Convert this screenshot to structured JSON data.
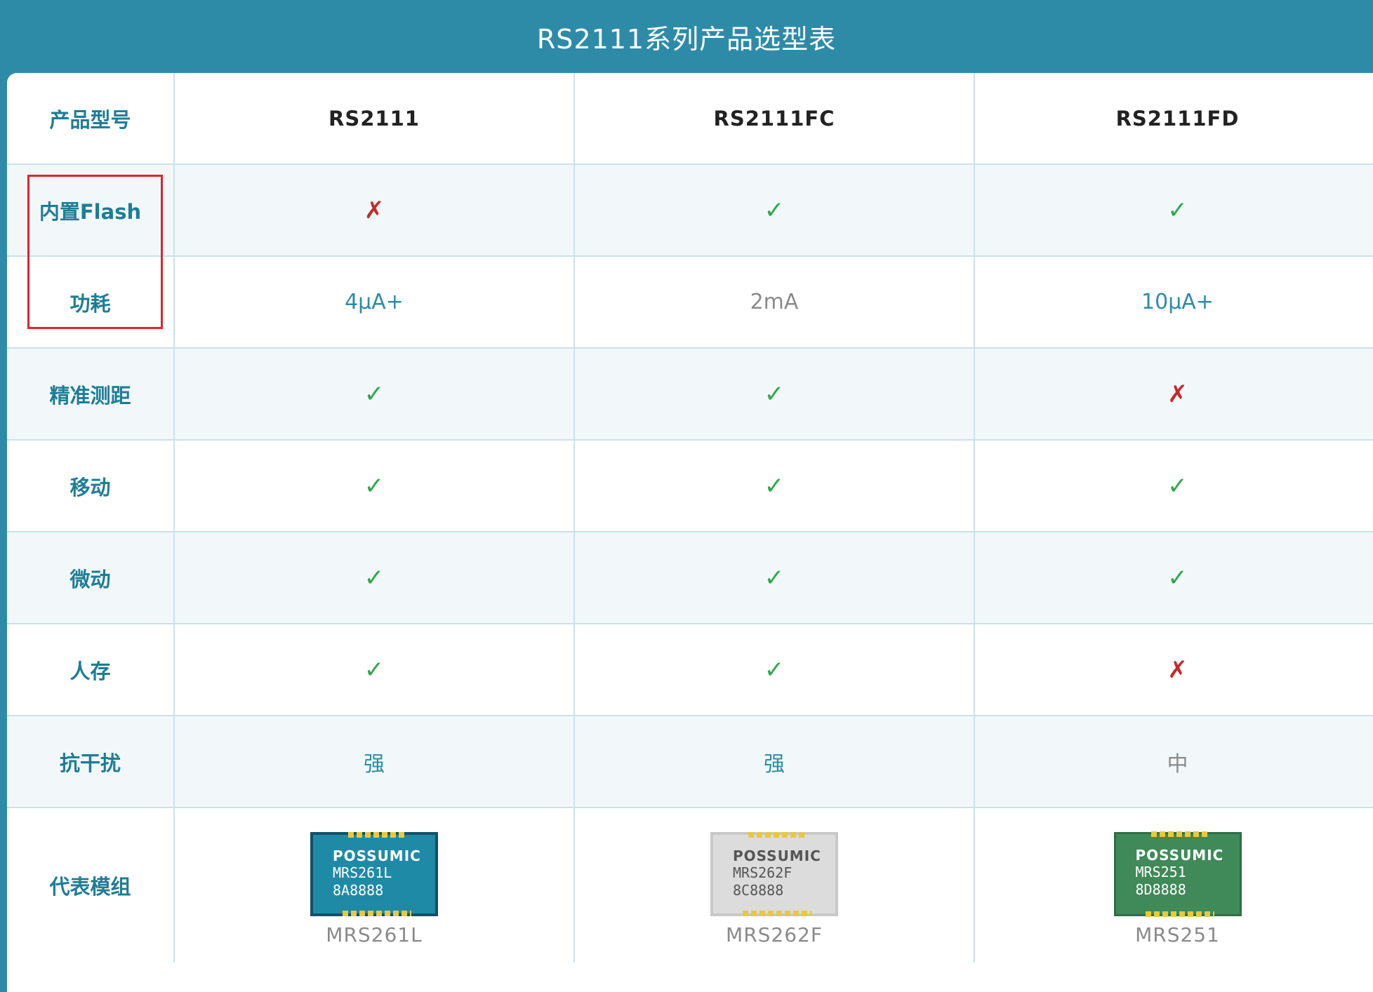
{
  "title": "RS2111系列产品选型表",
  "header": {
    "label": "产品型号",
    "models": [
      "RS2111",
      "RS2111FC",
      "RS2111FD"
    ]
  },
  "rows": [
    {
      "label": "内置Flash",
      "values": [
        "✗",
        "✓",
        "✓"
      ]
    },
    {
      "label": "功耗",
      "values": [
        "4μA+",
        "2mA",
        "10μA+"
      ]
    },
    {
      "label": "精准测距",
      "values": [
        "✓",
        "✓",
        "✗"
      ]
    },
    {
      "label": "移动",
      "values": [
        "✓",
        "✓",
        "✓"
      ]
    },
    {
      "label": "微动",
      "values": [
        "✓",
        "✓",
        "✓"
      ]
    },
    {
      "label": "人存",
      "values": [
        "✓",
        "✓",
        "✗"
      ]
    },
    {
      "label": "抗干扰",
      "values": [
        "强",
        "强",
        "中"
      ]
    }
  ],
  "modules": {
    "label": "代表模组",
    "items": [
      {
        "brand": "POSSUMIC",
        "line1": "MRS261L",
        "line2": "8A8888",
        "name": "MRS261L",
        "color": "#1f8aa6"
      },
      {
        "brand": "POSSUMIC",
        "line1": "MRS262F",
        "line2": "8C8888",
        "name": "MRS262F",
        "color": "#dcdcdc"
      },
      {
        "brand": "POSSUMIC",
        "line1": "MRS251",
        "line2": "8D8888",
        "name": "MRS251",
        "color": "#3f8a58"
      }
    ]
  },
  "colors": {
    "header_bg": "#2e8ba8",
    "check": "#2ea84a",
    "cross": "#c62828",
    "highlight": "#e0242c"
  }
}
